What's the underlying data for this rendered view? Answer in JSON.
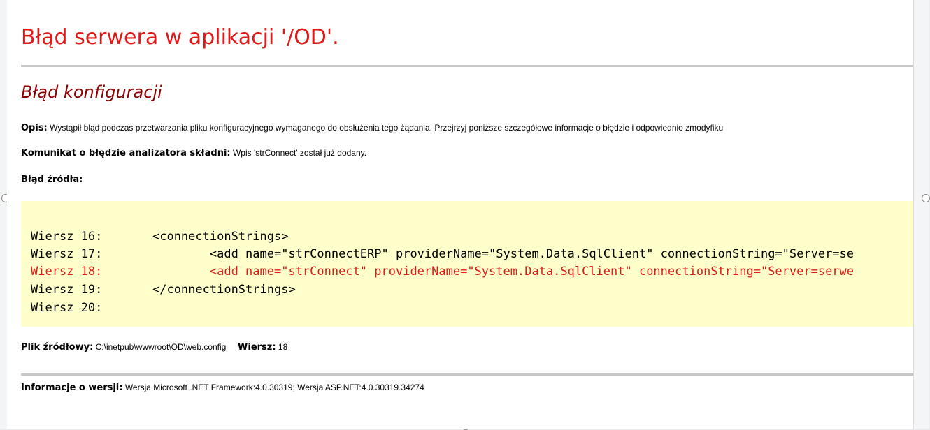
{
  "page": {
    "title": "Błąd serwera w aplikacji '/OD'.",
    "subtitle": "Błąd konfiguracji",
    "description_label": "Opis:",
    "description_text": "Wystąpił błąd podczas przetwarzania pliku konfiguracyjnego wymaganego do obsłużenia tego żądania. Przejrzyj poniższe szczegółowe informacje o błędzie i odpowiednio zmodyfiku",
    "parser_label": "Komunikat o błędzie analizatora składni:",
    "parser_text": "Wpis 'strConnect' został już dodany.",
    "source_error_label": "Błąd źródła:",
    "code_lines": [
      {
        "text": "Wiersz 16:       <connectionStrings>",
        "error": false
      },
      {
        "text": "Wiersz 17:               <add name=\"strConnectERP\" providerName=\"System.Data.SqlClient\" connectionString=\"Server=se",
        "error": false
      },
      {
        "text": "Wiersz 18:               <add name=\"strConnect\" providerName=\"System.Data.SqlClient\" connectionString=\"Server=serwe",
        "error": true
      },
      {
        "text": "Wiersz 19:       </connectionStrings>",
        "error": false
      },
      {
        "text": "Wiersz 20:",
        "error": false
      }
    ],
    "source_file_label": "Plik źródłowy:",
    "source_file_value": "C:\\inetpub\\wwwroot\\OD\\web.config",
    "line_label": "Wiersz:",
    "line_value": "18",
    "version_label": "Informacje o wersji:",
    "version_text": "Wersja Microsoft .NET Framework:4.0.30319; Wersja ASP.NET:4.0.30319.34274"
  }
}
